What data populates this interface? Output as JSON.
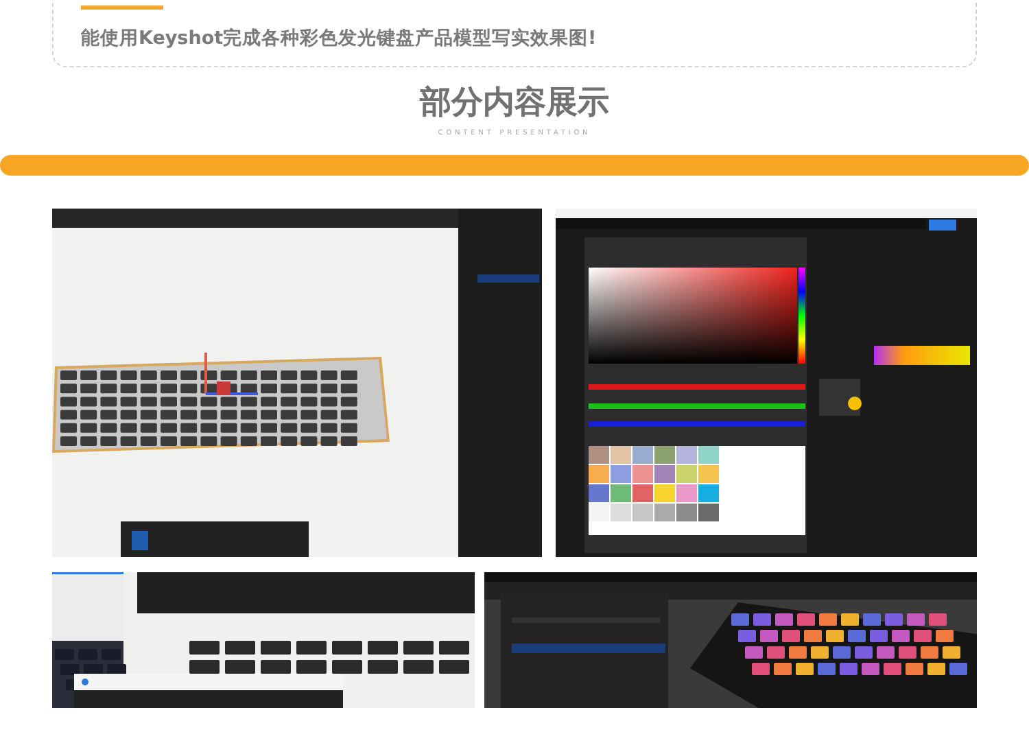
{
  "intro": {
    "text": "能使用Keyshot完成各种彩色发光键盘产品模型写实效果图!"
  },
  "section": {
    "title": "部分内容展示",
    "subtitle": "CONTENT PRESENTATION"
  },
  "gallery": [
    {
      "kind": "viewport"
    },
    {
      "kind": "picker"
    },
    {
      "kind": "toolbar"
    },
    {
      "kind": "render"
    }
  ]
}
